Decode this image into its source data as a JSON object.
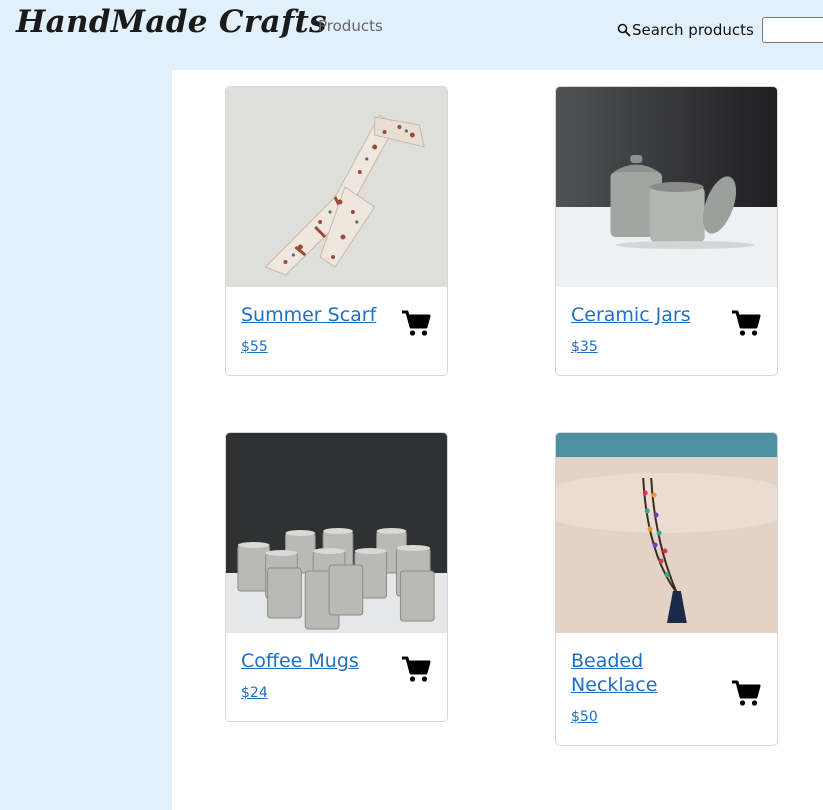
{
  "header": {
    "logo": "HandMade Crafts",
    "nav_products": "Products",
    "search_label": "Search products",
    "search_value": "",
    "search_placeholder": ""
  },
  "products": [
    {
      "name": "Summer Scarf",
      "price": "$55",
      "icon": "cart-icon"
    },
    {
      "name": "Ceramic Jars",
      "price": "$35",
      "icon": "cart-icon"
    },
    {
      "name": "Coffee Mugs",
      "price": "$24",
      "icon": "cart-icon"
    },
    {
      "name": "Beaded Necklace",
      "price": "$50",
      "icon": "cart-icon"
    }
  ],
  "colors": {
    "page_bg": "#e1f0fb",
    "link": "#1f6fc5",
    "main_bg": "#ffffff"
  }
}
